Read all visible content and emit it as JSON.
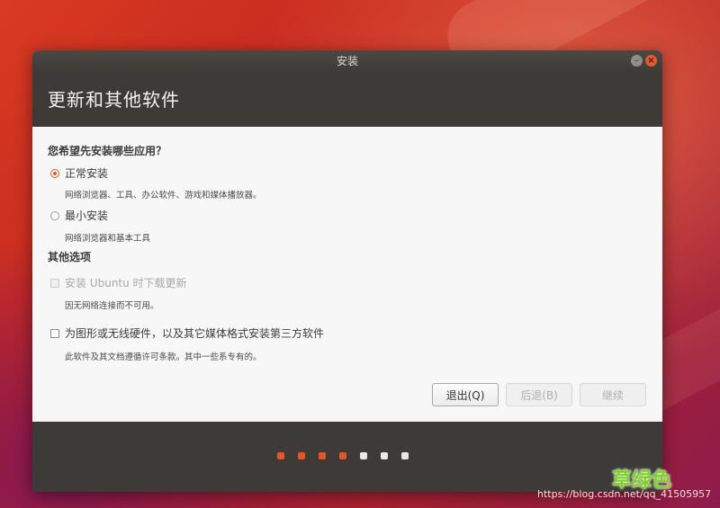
{
  "window": {
    "title": "安装"
  },
  "header": {
    "title": "更新和其他软件"
  },
  "main": {
    "question": "您希望先安装哪些应用？",
    "options": [
      {
        "label": "正常安装",
        "description": "网络浏览器、工具、办公软件、游戏和媒体播放器。",
        "selected": true
      },
      {
        "label": "最小安装",
        "description": "网络浏览器和基本工具",
        "selected": false
      }
    ],
    "other_section_title": "其他选项",
    "checkboxes": [
      {
        "label": "安装 Ubuntu 时下载更新",
        "description": "因无网络连接而不可用。",
        "checked": false,
        "enabled": false
      },
      {
        "label": "为图形或无线硬件，以及其它媒体格式安装第三方软件",
        "description": "此软件及其文档遵循许可条款。其中一些系专有的。",
        "checked": false,
        "enabled": true
      }
    ],
    "buttons": {
      "quit": "退出(Q)",
      "back": "后退(B)",
      "continue": "继续"
    }
  },
  "progress": {
    "total_steps": 7,
    "completed_steps": 4,
    "active_color": "#e95420",
    "inactive_color": "#e8e8e8"
  },
  "watermark": {
    "text": "草绿色",
    "url": "https://blog.csdn.net/qq_41505957"
  },
  "colors": {
    "accent": "#e95420",
    "header_bg": "#3c3b37",
    "content_bg": "#f7f7f7"
  }
}
